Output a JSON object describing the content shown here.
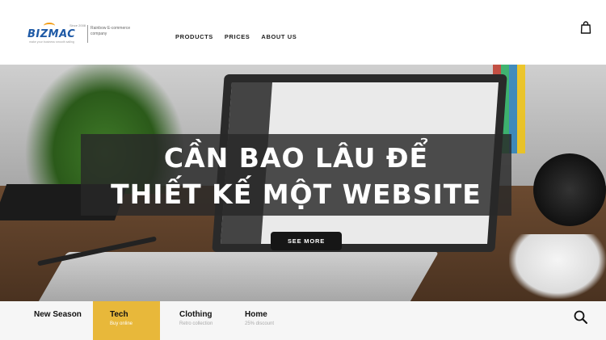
{
  "brand": {
    "wordmark": "BIZMAC",
    "since": "Since 2008",
    "slogan": "make your business smooth sailing",
    "company_line": "Rainbow E-commerce company"
  },
  "nav": {
    "items": [
      "PRODUCTS",
      "PRICES",
      "ABOUT US"
    ]
  },
  "icons": {
    "cart": "shopping-bag-icon",
    "search": "search-icon"
  },
  "hero": {
    "headline_line1": "CẦN BAO LÂU ĐỂ",
    "headline_line2": "THIẾT KẾ MỘT WEBSITE",
    "cta": "SEE MORE"
  },
  "tabs": [
    {
      "title": "New Season",
      "subtitle": ""
    },
    {
      "title": "Tech",
      "subtitle": "Buy online"
    },
    {
      "title": "Clothing",
      "subtitle": "Retro collection"
    },
    {
      "title": "Home",
      "subtitle": "25% discount"
    }
  ],
  "colors": {
    "brand_blue": "#1f5aa6",
    "accent_yellow": "#e8b83a",
    "tab_bar_bg": "#f6f6f6",
    "headline_bg": "#282828"
  }
}
